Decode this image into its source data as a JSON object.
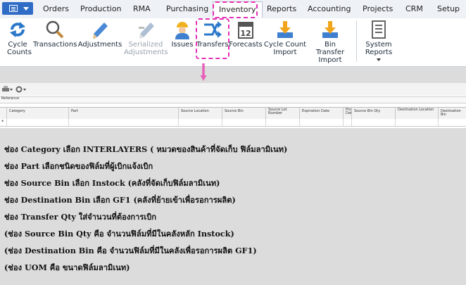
{
  "menu": {
    "items": [
      "Orders",
      "Production",
      "RMA",
      "Purchasing",
      "Inventory",
      "Reports",
      "Accounting",
      "Projects",
      "CRM",
      "Setup"
    ],
    "active": "Inventory"
  },
  "ribbon": {
    "buttons": [
      {
        "label": "Cycle Counts",
        "icon": "cycle-counts-icon"
      },
      {
        "label": "Transactions",
        "icon": "magnifier-icon"
      },
      {
        "label": "Adjustments",
        "icon": "pencil-icon"
      },
      {
        "label": "Serialized Adjustments",
        "icon": "serialized-pencil-icon",
        "disabled": true
      },
      {
        "label": "Issues",
        "icon": "worker-icon"
      },
      {
        "label": "Transfers",
        "icon": "transfer-arrows-icon",
        "highlighted": true
      },
      {
        "label": "Forecasts",
        "icon": "calendar-icon"
      },
      {
        "label": "Cycle Count Import",
        "icon": "download-tray-icon"
      },
      {
        "label": "Bin Transfer Import",
        "icon": "download-tray-icon"
      },
      {
        "label": "System Reports",
        "icon": "document-icon",
        "dropdown": true
      }
    ]
  },
  "grid": {
    "reference_label": "Reference",
    "columns": [
      "Category",
      "Part",
      "Source Location",
      "Source Bin",
      "Source Lot Number",
      "Expiration Date",
      "Pro Dat",
      "Source Bin Qty",
      "Destination Location",
      "Destination Bin"
    ],
    "row_marker": "*"
  },
  "instructions": [
    "ช่อง Category เลือก INTERLAYERS ( หมวดของสินค้าที่จัดเก็บ ฟิล์มลามิเนท)",
    "ช่อง Part เลือกชนิดของฟิล์มที่ผู้เบิกแจ้งเบิก",
    "ช่อง Source Bin เลือก Instock (คลังที่จัดเก็บฟิล์มลามิเนท)",
    "ช่อง Destination Bin เลือก GF1 (คลังที่ย้ายเข้าเพื่อรอการผลิต)",
    "ช่อง Transfer Qty ใส่จำนวนที่ต้องการเบิก",
    "(ช่อง Source Bin Qty คือ จำนวนฟิล์มที่มีในคลังหลัก Instock)",
    "(ช่อง Destination Bin คือ จำนวนฟิล์มที่มีในคลังเพื่อรอการผลิต GF1)",
    "(ช่อง UOM  คือ ขนาดฟิล์มลามิเนท)"
  ],
  "colors": {
    "accent": "#2f6cc6",
    "highlight": "#e52fb4",
    "icon_blue": "#2b78c9"
  }
}
